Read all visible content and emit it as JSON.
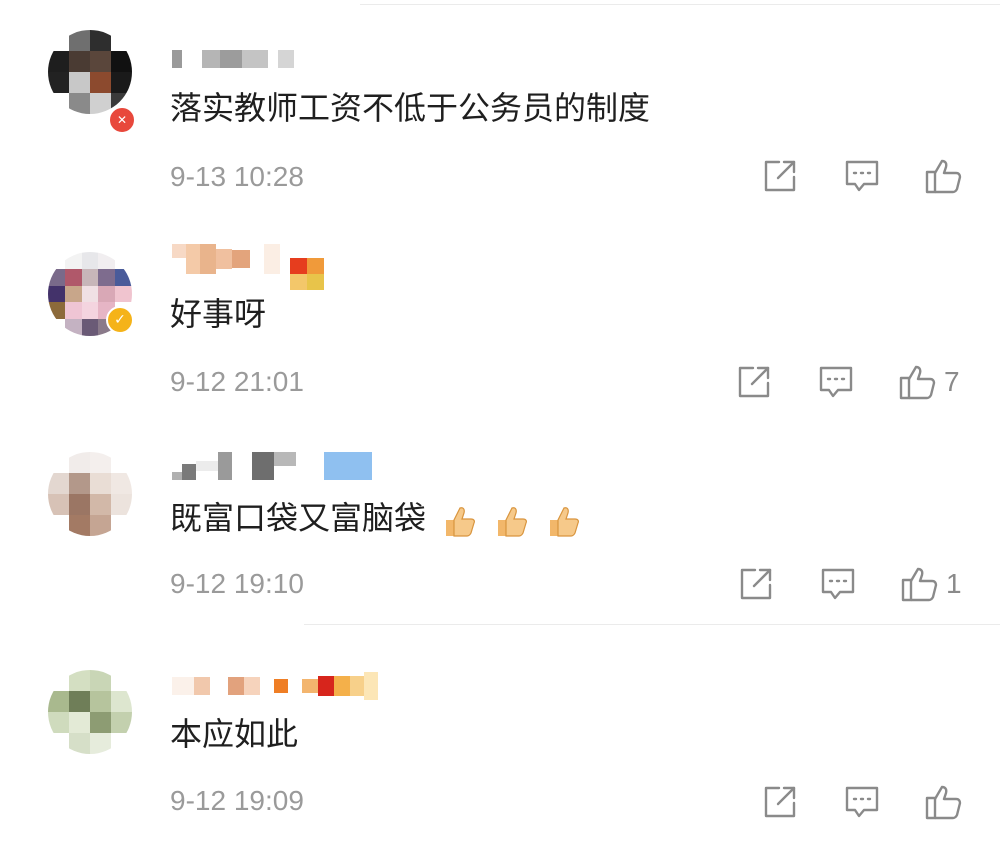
{
  "comments": [
    {
      "text": "落实教师工资不低于公务员的制度",
      "time": "9-13 10:28",
      "likes": "",
      "badge_icon": "red-v-badge-icon",
      "emoji_count": 0
    },
    {
      "text": "好事呀",
      "time": "9-12 21:01",
      "likes": "7",
      "badge_icon": "verified-check-badge-icon",
      "emoji_count": 0
    },
    {
      "text": "既富口袋又富脑袋",
      "time": "9-12 19:10",
      "likes": "1",
      "badge_icon": "",
      "emoji_count": 3
    },
    {
      "text": "本应如此",
      "time": "9-12 19:09",
      "likes": "",
      "badge_icon": "",
      "emoji_count": 0
    }
  ],
  "icons": {
    "share": "share-icon",
    "reply": "comment-icon",
    "like": "thumbs-up-icon",
    "emoji": "thumbs-up-emoji"
  },
  "colors": {
    "time_text": "#9a9a9a",
    "icon_gray": "#8a8a8a",
    "badge_red": "#e8483c",
    "badge_gold": "#f5b319"
  }
}
